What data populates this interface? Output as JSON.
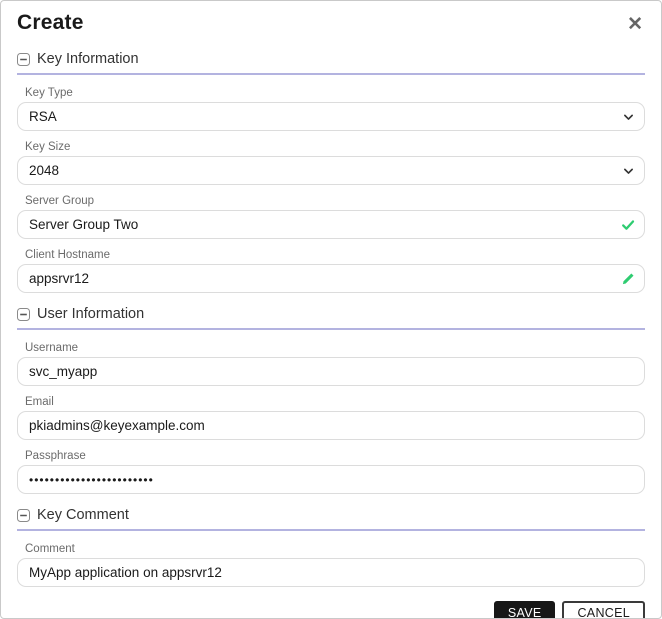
{
  "modal": {
    "title": "Create",
    "close_glyph": "✕"
  },
  "sections": {
    "key_information": {
      "title": "Key Information"
    },
    "user_information": {
      "title": "User Information"
    },
    "key_comment": {
      "title": "Key Comment"
    }
  },
  "fields": {
    "key_type": {
      "label": "Key Type",
      "value": "RSA",
      "control": "select"
    },
    "key_size": {
      "label": "Key Size",
      "value": "2048",
      "control": "select"
    },
    "server_group": {
      "label": "Server Group",
      "value": "Server Group Two",
      "status_icon": "check"
    },
    "client_hostname": {
      "label": "Client Hostname",
      "value": "appsrvr12",
      "status_icon": "pencil"
    },
    "username": {
      "label": "Username",
      "value": "svc_myapp"
    },
    "email": {
      "label": "Email",
      "value": "pkiadmins@keyexample.com"
    },
    "passphrase": {
      "label": "Passphrase",
      "value": "••••••••••••••••••••••••",
      "masked": true
    },
    "comment": {
      "label": "Comment",
      "value": "MyApp application on appsrvr12"
    }
  },
  "buttons": {
    "save": "SAVE",
    "cancel": "CANCEL"
  },
  "colors": {
    "section_underline": "#b3b3e0",
    "success_green": "#2ecc71",
    "save_button_bg": "#171717"
  }
}
